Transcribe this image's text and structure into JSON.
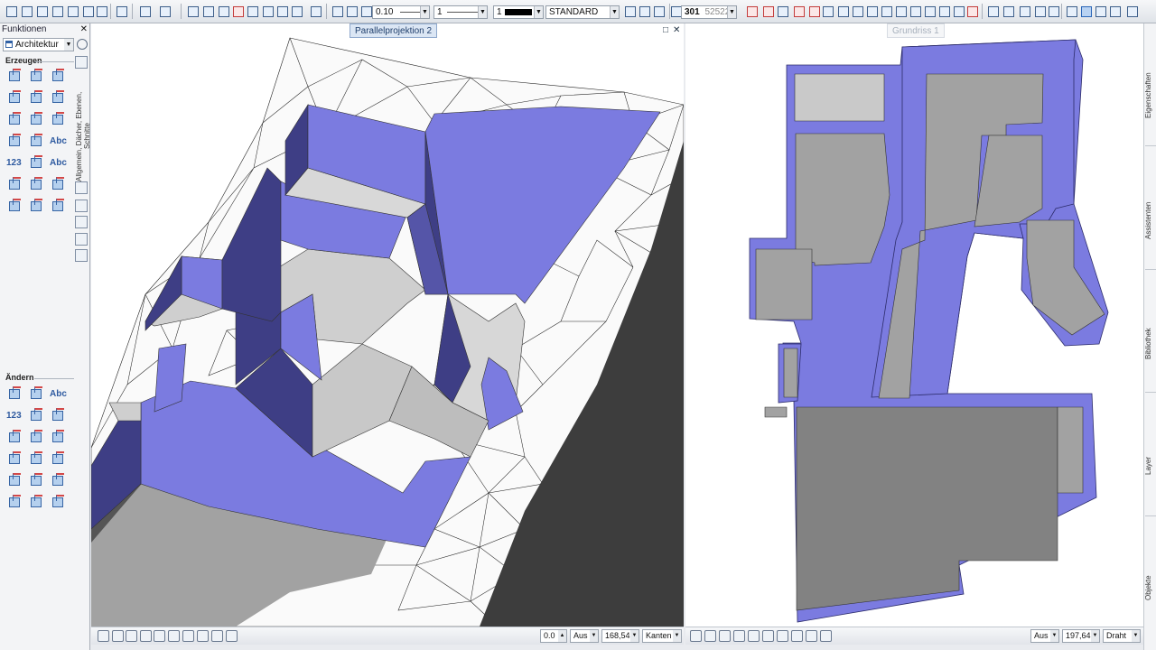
{
  "toolbar": {
    "pen_thickness": "0.10",
    "line_type": "1",
    "color_index": "1",
    "layer": "STANDARD",
    "elevation": "301",
    "elevation_suffix": "52522"
  },
  "left_panel": {
    "title": "Funktionen",
    "module": "Architektur",
    "section_create": "Erzeugen",
    "section_modify": "Ändern",
    "vertical_tab": "Allgemein, Dächer, Ebenen, Schnitte"
  },
  "viewports": {
    "left": {
      "title": "Parallelprojektion 2",
      "angle": "0.0",
      "mode": "Aus",
      "scale": "168,54",
      "display": "Kanten"
    },
    "right": {
      "title": "Grundriss 1",
      "mode": "Aus",
      "scale": "197,64",
      "display": "Draht"
    }
  },
  "right_tabs": [
    "Eigenschaften",
    "Assistenten",
    "Bibliothek",
    "Layer",
    "Objekte"
  ],
  "colors": {
    "wall": "#7b7be0",
    "wall_dark": "#3e3e85",
    "floor": "#a3a3a3",
    "floor_light": "#cfcfcf",
    "terrain": "#3d3d3d"
  }
}
